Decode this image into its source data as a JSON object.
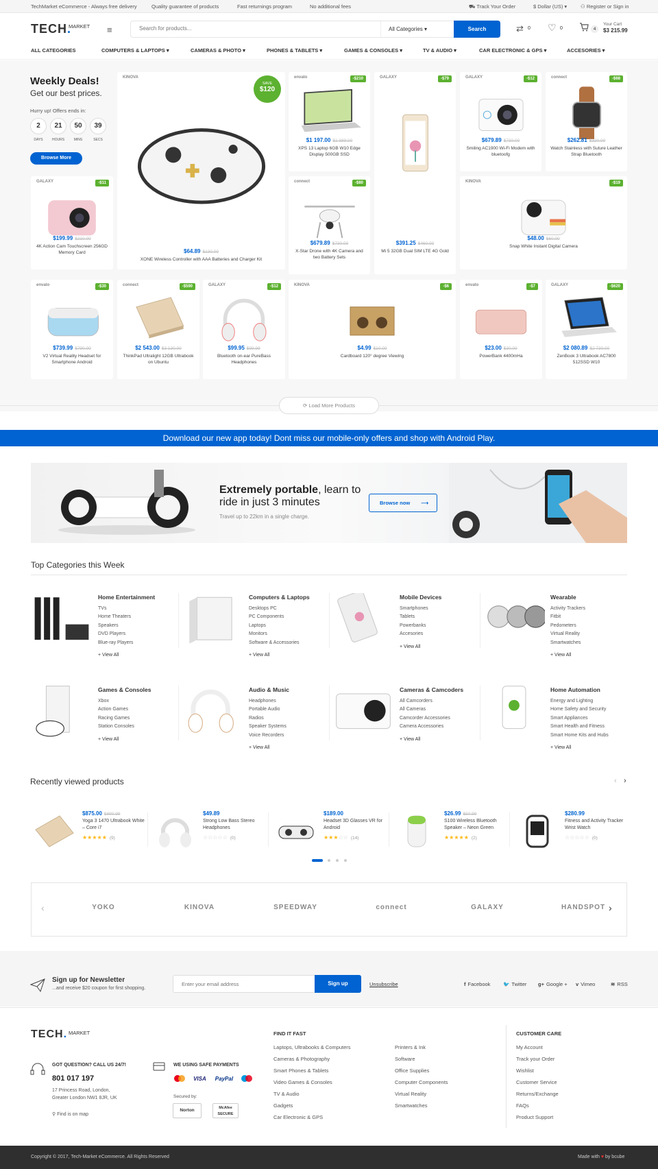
{
  "topbar": {
    "welcome": "TechMarket eCommerce - Always free delivery",
    "quality": "Quality guarantee of products",
    "returns": "Fast returnings program",
    "fees": "No additional fees",
    "track": "Track Your Order",
    "currency": "$ Dollar (US)",
    "register": "Register or Sign in"
  },
  "header": {
    "logo": "TECH",
    "logo_sub": "MARKET",
    "search_placeholder": "Search for products...",
    "category_select": "All Categories",
    "search_button": "Search",
    "compare_count": "0",
    "wishlist_count": "0",
    "cart_count": "4",
    "cart_label": "Your Cart",
    "cart_total": "$3 215.99"
  },
  "nav": [
    "ALL CATEGORIES",
    "COMPUTERS & LAPTOPS",
    "CAMERAS & PHOTO",
    "PHONES & TABLETS",
    "GAMES & CONSOLES",
    "TV & AUDIO",
    "CAR ELECTRONIC & GPS",
    "ACCESORIES"
  ],
  "deals": {
    "title": "Weekly Deals!",
    "subtitle": "Get our best prices.",
    "hurry": "Hurry up! Offers ends in:",
    "countdown": [
      {
        "v": "2",
        "l": "DAYS"
      },
      {
        "v": "21",
        "l": "HOURS"
      },
      {
        "v": "50",
        "l": "MINS"
      },
      {
        "v": "39",
        "l": "SECS"
      }
    ],
    "browse": "Browse More",
    "save_label": "SAVE",
    "save_amount": "$120"
  },
  "products": [
    {
      "brand": "KINOVA",
      "discount": "",
      "price": "$64.89",
      "old": "$130.00",
      "name": "XONE Wireless Controller with AAA Batteries and Charger Kit"
    },
    {
      "brand": "envato",
      "discount": "-$210",
      "price": "$1 197.00",
      "old": "$1 389.00",
      "name": "XPS 13 Laptop 6GB W10 Edge Display 500GB SSD"
    },
    {
      "brand": "GALAXY",
      "discount": "-$79",
      "price": "$391.25",
      "old": "$460.00",
      "name": "Mi 5 32GB Dual SIM LTE 4G Gold"
    },
    {
      "brand": "GALAXY",
      "discount": "-$12",
      "price": "$679.89",
      "old": "$730.00",
      "name": "Smiling AC1900 Wi-Fi Modem with bluetoofg"
    },
    {
      "brand": "connect",
      "discount": "-$68",
      "price": "$262.81",
      "old": "$320.00",
      "name": "Watch Stainless with Suture Leather Strap Bluetooth"
    },
    {
      "brand": "GALAXY",
      "discount": "-$11",
      "price": "$199.99",
      "old": "$210.00",
      "name": "4K Action Cam Touchscreen 256GD Memory Card"
    },
    {
      "brand": "connect",
      "discount": "-$80",
      "price": "$679.89",
      "old": "$730.00",
      "name": "X-Star Drone with 4K Camera and two Battery Sets"
    },
    {
      "brand": "KINOVA",
      "discount": "-$19",
      "price": "$48.00",
      "old": "$60.00",
      "name": "Snap White Instant Digital Camera"
    },
    {
      "brand": "envato",
      "discount": "-$30",
      "price": "$739.99",
      "old": "$790.00",
      "name": "V2 Virtual Reality Headset for Smartphone Android"
    },
    {
      "brand": "connect",
      "discount": "-$590",
      "price": "$2 543.00",
      "old": "$3 130.00",
      "name": "ThinkPad Ultralight 12GB Ultrabook on Ubuntu"
    },
    {
      "brand": "GALAXY",
      "discount": "-$12",
      "price": "$99.95",
      "old": "$99.99",
      "name": "Bluetooth on-ear PureBass Headphones"
    },
    {
      "brand": "KINOVA",
      "discount": "-$6",
      "price": "$4.99",
      "old": "$10.00",
      "name": "Cardboard 120° degree Viewing"
    },
    {
      "brand": "envato",
      "discount": "-$7",
      "price": "$23.00",
      "old": "$30.00",
      "name": "PowerBank 4400mHa"
    },
    {
      "brand": "GALAXY",
      "discount": "-$620",
      "price": "$2 080.89",
      "old": "$2 730.00",
      "name": "ZenBook 3 Ultrabook AC7800 512SSD W10"
    }
  ],
  "load_more": "Load More Products",
  "app_banner": "Download our new app today! Dont miss our mobile-only offers and shop with Android Play.",
  "promo": {
    "title_bold": "Extremely portable",
    "title_rest": ", learn to ride in just 3 minutes",
    "sub": "Travel up to 22km in a single charge.",
    "button": "Browse now"
  },
  "top_categories": {
    "title": "Top Categories this Week",
    "items": [
      {
        "name": "Home Entertainment",
        "links": [
          "TVs",
          "Home Theaters",
          "Speakers",
          "DVD Players",
          "Blue-ray Players"
        ],
        "more": "+ View All"
      },
      {
        "name": "Computers & Laptops",
        "links": [
          "Desktops  PC",
          "PC Components",
          "Laptops",
          "Monitors",
          "Software & Accessories"
        ],
        "more": "+ View All"
      },
      {
        "name": "Mobile Devices",
        "links": [
          "Smartphones",
          "Tablets",
          "Powerbanks",
          "Accesories"
        ],
        "more": "+ View All"
      },
      {
        "name": "Wearable",
        "links": [
          "Activity Trackers",
          "Fitbit",
          "Pedometers",
          "Virtual Reality",
          "Smartwatches"
        ],
        "more": "+ View All"
      },
      {
        "name": "Games & Consoles",
        "links": [
          "Xbox",
          "Action Games",
          "Racing Games",
          "Station Consoles"
        ],
        "more": "+ View All"
      },
      {
        "name": "Audio & Music",
        "links": [
          "Headphones",
          "Portable Audio",
          "Radios",
          "Speaker Systems",
          "Voice Recorders"
        ],
        "more": "+ View All"
      },
      {
        "name": "Cameras & Camcoders",
        "links": [
          "All Camcorders",
          "All Cameras",
          "Camcorder Accessories",
          "Camera Accessories"
        ],
        "more": "+ View All"
      },
      {
        "name": "Home Automation",
        "links": [
          "Energy and Lighting",
          "Home Safety and Security",
          "Smart Appliances",
          "Smart Health and Fitness",
          "Smart Home Kits and Hubs"
        ],
        "more": "+ View All"
      }
    ]
  },
  "recent": {
    "title": "Recently viewed products",
    "items": [
      {
        "price": "$875.00",
        "old": "$890.99",
        "name": "Yoga 3 1470 Ultrabook White – Core i7",
        "rating": 5,
        "reviews": "(9)"
      },
      {
        "price": "$49.89",
        "old": "",
        "name": "Strong Low Bass Stereo Headphones",
        "rating": 0,
        "reviews": "(0)"
      },
      {
        "price": "$189.00",
        "old": "",
        "name": "Headset 3D Glasses VR for Android",
        "rating": 3,
        "reviews": "(14)"
      },
      {
        "price": "$26.99",
        "old": "$50.99",
        "name": "S100 Wireless Bluetooth Speaker – Neon Green",
        "rating": 5,
        "reviews": "(2)"
      },
      {
        "price": "$280.99",
        "old": "",
        "name": "Fitness and Activity Tracker Wrist Watch",
        "rating": 0,
        "reviews": "(0)"
      }
    ]
  },
  "brands": [
    "YOKO",
    "KINOVA",
    "SPEEDWAY",
    "connect",
    "GALAXY",
    "HANDSPOT"
  ],
  "newsletter": {
    "title": "Sign up for Newsletter",
    "sub": "...and receive $20 coupon for first shopping.",
    "placeholder": "Enter your email address",
    "button": "Sign up",
    "unsubscribe": "Unsubscribe",
    "social": [
      "Facebook",
      "Twitter",
      "Google +",
      "Vimeo",
      "RSS"
    ]
  },
  "footer": {
    "question": "GOT QUESTION? CALL US 24/7!",
    "phone": "801 017 197",
    "address1": "17 Princess Road, London,",
    "address2": "Greater London NW1 8JR, UK",
    "map": "Find is on map",
    "payments_title": "WE USING SAFE PAYMENTS",
    "payment_methods": [
      "mastercard",
      "VISA",
      "PayPal",
      "maestro"
    ],
    "secured": "Secured by:",
    "seals": [
      "Norton",
      "McAfee SECURE"
    ],
    "find_title": "FIND IT FAST",
    "find_col1": [
      "Laptops, Ultrabooks & Computers",
      "Cameras & Photography",
      "Smart Phones & Tablets",
      "Video Games & Consoles",
      "TV & Audio",
      "Gadgets",
      "Car Electronic & GPS"
    ],
    "find_col2": [
      "Printers & Ink",
      "Software",
      "Office Supplies",
      "Computer Components",
      "Virtual Reality",
      "Smartwatches"
    ],
    "care_title": "CUSTOMER CARE",
    "care": [
      "My Account",
      "Track your Order",
      "Wishlist",
      "Customer Service",
      "Returns/Exchange",
      "FAQs",
      "Product Support"
    ],
    "copyright": "Copyright © 2017, Tech-Market eCommerce. All Rights Reserved",
    "made_with": "Made with",
    "by": "by bcube"
  },
  "colors": {
    "accent": "#0063d1",
    "discount": "#5cb130",
    "dark_footer": "#2f2f2f"
  }
}
